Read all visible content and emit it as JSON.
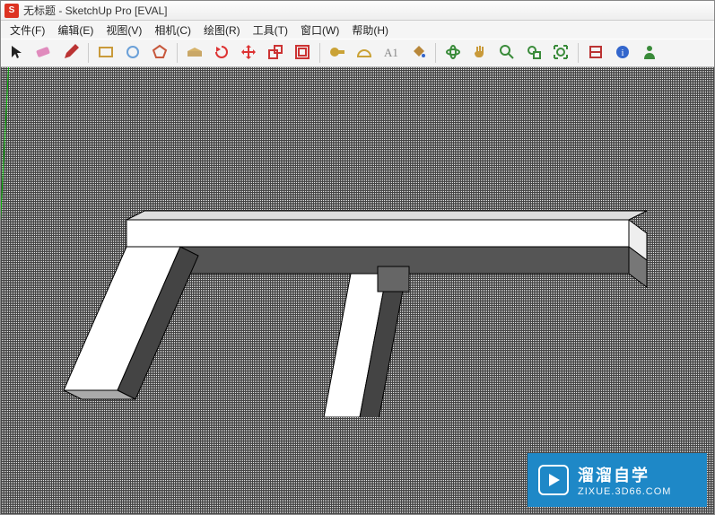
{
  "window": {
    "title": "无标题 - SketchUp Pro [EVAL]"
  },
  "menu": {
    "items": [
      "文件(F)",
      "编辑(E)",
      "视图(V)",
      "相机(C)",
      "绘图(R)",
      "工具(T)",
      "窗口(W)",
      "帮助(H)"
    ]
  },
  "toolbar": {
    "groups": [
      {
        "tools": [
          "select",
          "eraser",
          "pencil"
        ]
      },
      {
        "tools": [
          "rectangle",
          "circle",
          "polygon"
        ]
      },
      {
        "tools": [
          "pushpull",
          "rotate",
          "move",
          "scale",
          "offset"
        ]
      },
      {
        "tools": [
          "tape",
          "protractor",
          "text",
          "paintbucket"
        ]
      },
      {
        "tools": [
          "orbit",
          "pan",
          "zoom",
          "zoomwindow",
          "zoomextents"
        ]
      },
      {
        "tools": [
          "component",
          "info",
          "person"
        ]
      }
    ],
    "colors": {
      "select": "#222",
      "eraser": "#e08bbd",
      "pencil": "#b33",
      "rectangle": "#c99a3a",
      "circle": "#6aa0d8",
      "polygon": "#c7583c",
      "pushpull": "#d6b36b",
      "rotate": "#d33",
      "move": "#d33",
      "scale": "#c33",
      "offset": "#c33",
      "tape": "#caa236",
      "protractor": "#caa236",
      "text": "#888",
      "paintbucket": "#b8873a",
      "orbit": "#3a8b3a",
      "pan": "#c99a3a",
      "zoom": "#3a8b3a",
      "zoomwindow": "#3a8b3a",
      "zoomextents": "#3a8b3a",
      "component": "#b33",
      "info": "#36c",
      "person": "#3a8b3a"
    }
  },
  "watermark": {
    "brand": "溜溜自学",
    "url": "ZIXUE.3D66.COM"
  }
}
